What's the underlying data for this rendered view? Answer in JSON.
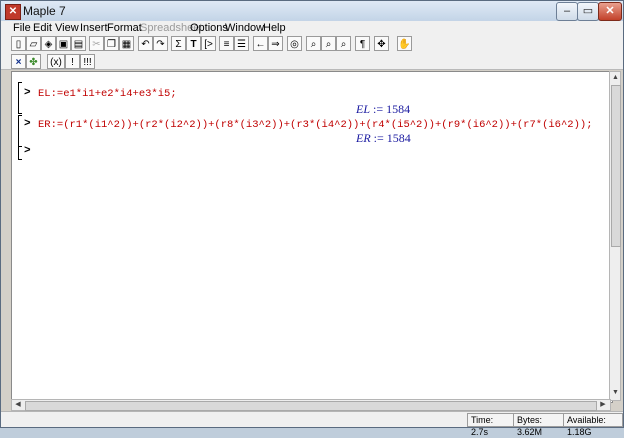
{
  "window": {
    "title": "Maple 7",
    "app_icon": "maple-leaf-icon"
  },
  "menubar": {
    "items": [
      "File",
      "Edit",
      "View",
      "Insert",
      "Format",
      "Spreadsheet",
      "Options",
      "Window",
      "Help"
    ],
    "disabled": [
      "Spreadsheet"
    ]
  },
  "toolbar": {
    "buttons": [
      "new-icon",
      "open-icon",
      "open-url-icon",
      "save-icon",
      "print-icon",
      "cut-icon",
      "copy-icon",
      "paste-icon",
      "undo-icon",
      "redo-icon",
      "sum-icon",
      "text-icon",
      "math-input-icon",
      "exec-group-icon",
      "exec-all-icon",
      "back-icon",
      "forward-icon",
      "stop-icon",
      "zoom-small-icon",
      "zoom-normal-icon",
      "zoom-large-icon",
      "paragraph-icon",
      "expand-icon",
      "restart-icon"
    ],
    "labels": {
      "sum": "Σ",
      "text": "T",
      "math_input": "[>",
      "paragraph": "¶"
    }
  },
  "toolbar2": {
    "labels": {
      "x": "×",
      "eval": "(x)",
      "excl": "!",
      "triple": "!!!"
    }
  },
  "worksheet": {
    "groups": [
      {
        "prompt": ">",
        "input": "EL:=e1*i1+e2*i4+e3*i5;",
        "output_var": "EL",
        "output_assign": ":=",
        "output_value": "1584"
      },
      {
        "prompt": ">",
        "input": "ER:=(r1*(i1^2))+(r2*(i2^2))+(r8*(i3^2))+(r3*(i4^2))+(r4*(i5^2))+(r9*(i6^2))+(r7*(i6^2));",
        "output_var": "ER",
        "output_assign": ":=",
        "output_value": "1584"
      },
      {
        "prompt": ">",
        "input": ""
      }
    ]
  },
  "statusbar": {
    "time": "Time:   2.7s",
    "bytes": "Bytes: 3.62M",
    "available": "Available: 1.18G"
  },
  "colors": {
    "input": "#c00000",
    "output": "#1a1aa0"
  }
}
